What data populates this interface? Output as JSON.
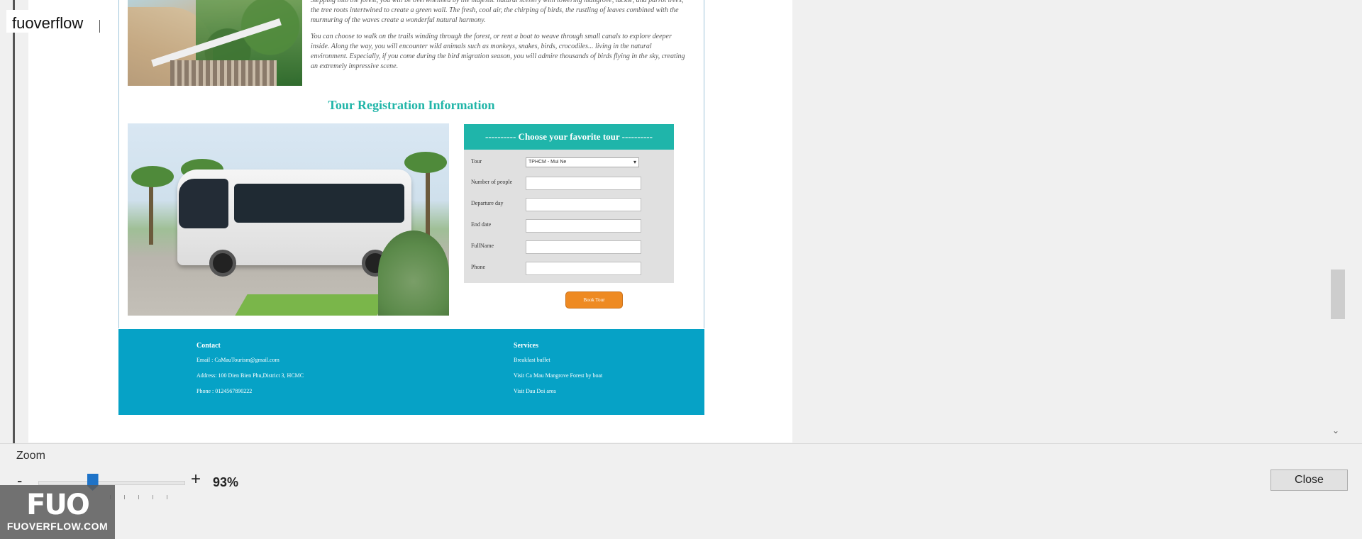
{
  "app": {
    "brand": "fuoverflow"
  },
  "document": {
    "para1": "Stepping into the forest, you will be overwhelmed by the majestic natural scenery with towering mangrove, tackle, and parrot trees, the tree roots intertwined to create a green wall. The fresh, cool air, the chirping of birds, the rustling of leaves combined with the murmuring of the waves create a wonderful natural harmony.",
    "para2": "You can choose to walk on the trails winding through the forest, or rent a boat to weave through small canals to explore deeper inside. Along the way, you will encounter wild animals such as monkeys, snakes, birds, crocodiles... living in the natural environment. Especially, if you come during the bird migration season, you will admire thousands of birds flying in the sky, creating an extremely impressive scene.",
    "reg_title": "Tour Registration Information",
    "form": {
      "header": "---------- Choose your favorite tour ----------",
      "tour_label": "Tour",
      "tour_value": "TPHCM - Mui Ne",
      "people_label": "Number of people",
      "departure_label": "Departure day",
      "end_label": "End date",
      "fullname_label": "FullName",
      "phone_label": "Phone",
      "book_button": "Book Tour"
    },
    "footer": {
      "contact_title": "Contact",
      "email": "Email : CaMauTourism@gmail.com",
      "address": "Address: 100 Dien Bien Phu,District 3, HCMC",
      "phone": "Phone : 0124567890222",
      "services_title": "Services",
      "service1": "Breakfast buffet",
      "service2": "Visit Ca Mau Mangrove Forest by boat",
      "service3": "Visit Dau Doi area"
    }
  },
  "zoom": {
    "label": "Zoom",
    "minus": "-",
    "plus": "+",
    "value": "93%",
    "level_fraction": 0.37
  },
  "close_button": "Close",
  "logo": {
    "mark": "FUO",
    "site": "FUOVERFLOW.COM"
  },
  "colors": {
    "accent_teal": "#1fb5aa",
    "footer_blue": "#06a2c6",
    "button_orange": "#ee8a22",
    "slider_blue": "#1e73c8"
  }
}
